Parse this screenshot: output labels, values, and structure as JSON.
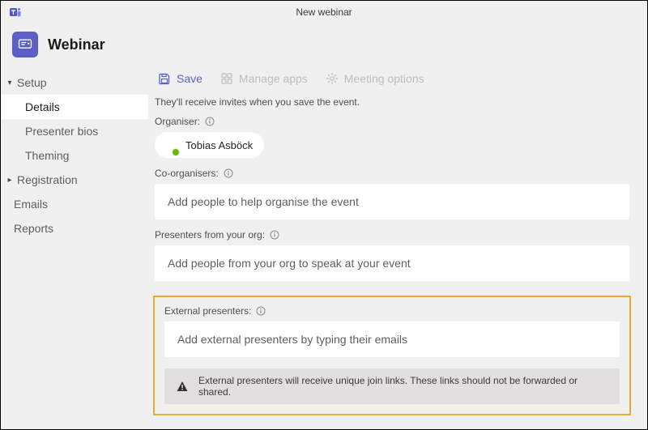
{
  "window": {
    "title": "New webinar"
  },
  "header": {
    "title": "Webinar"
  },
  "sidebar": {
    "setup_label": "Setup",
    "details_label": "Details",
    "presenter_bios_label": "Presenter bios",
    "theming_label": "Theming",
    "registration_label": "Registration",
    "emails_label": "Emails",
    "reports_label": "Reports"
  },
  "toolbar": {
    "save_label": "Save",
    "manage_apps_label": "Manage apps",
    "meeting_options_label": "Meeting options"
  },
  "content": {
    "description": "They'll receive invites when you save the event.",
    "organiser_label": "Organiser:",
    "organiser_name": "Tobias Asböck",
    "co_organisers_label": "Co-organisers:",
    "co_organisers_placeholder": "Add people to help organise the event",
    "presenters_org_label": "Presenters from your org:",
    "presenters_org_placeholder": "Add people from your org to speak at your event",
    "external_presenters_label": "External presenters:",
    "external_presenters_placeholder": "Add external presenters by typing their emails",
    "external_notice": "External presenters will receive unique join links. These links should not be forwarded or shared."
  },
  "colors": {
    "accent": "#5b5fc7",
    "highlight_border": "#e8a93a",
    "presence_available": "#6bb700"
  }
}
